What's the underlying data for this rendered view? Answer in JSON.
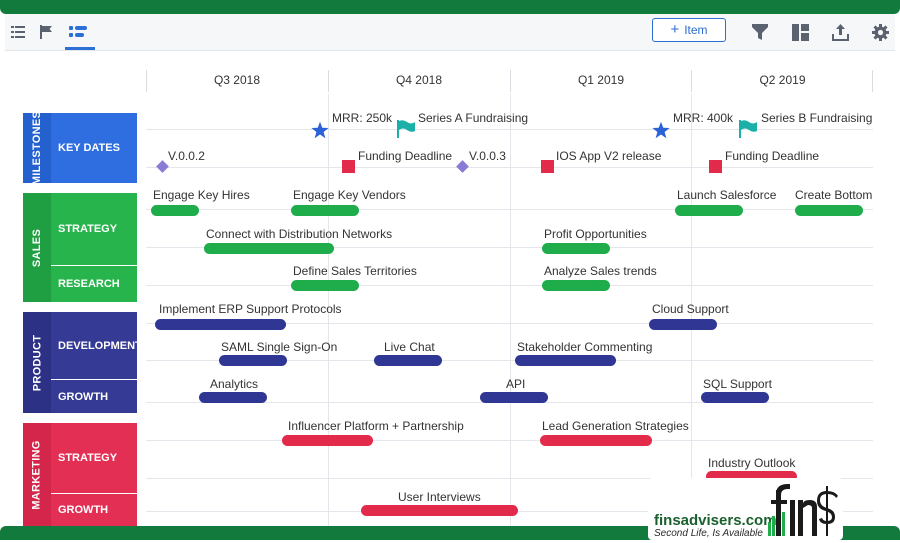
{
  "toolbar": {
    "add_button_label": "Item",
    "add_button_icon": "plus-icon",
    "left_icons": [
      "list-view-icon",
      "flag-icon",
      "timeline-icon"
    ],
    "right_icons": [
      "filter-icon",
      "layout-icon",
      "export-icon",
      "gear-icon"
    ]
  },
  "timeline": {
    "quarters": [
      "Q3 2018",
      "Q4 2018",
      "Q1 2019",
      "Q2 2019"
    ]
  },
  "groups": [
    {
      "name": "MILESTONES",
      "color": "#2e6ee0",
      "rows": [
        "KEY DATES"
      ]
    },
    {
      "name": "SALES",
      "color": "#27b44d",
      "rows": [
        "STRATEGY",
        "RESEARCH"
      ]
    },
    {
      "name": "PRODUCT",
      "color": "#353a94",
      "rows": [
        "DEVELOPMENT",
        "GROWTH"
      ]
    },
    {
      "name": "MARKETING",
      "color": "#e42f55",
      "rows": [
        "STRATEGY",
        "GROWTH"
      ]
    }
  ],
  "milestones": [
    {
      "label": "MRR: 250k",
      "shape": "star-icon"
    },
    {
      "label": "Series A Fundraising",
      "shape": "flag-icon"
    },
    {
      "label": "MRR: 400k",
      "shape": "star-icon"
    },
    {
      "label": "Series B Fundraising",
      "shape": "flag-icon"
    },
    {
      "label": "V.0.0.2",
      "shape": "diamond-icon"
    },
    {
      "label": "Funding Deadline",
      "shape": "square-icon"
    },
    {
      "label": "V.0.0.3",
      "shape": "diamond-icon"
    },
    {
      "label": "IOS App V2 release",
      "shape": "square-icon"
    },
    {
      "label": "Funding Deadline",
      "shape": "square-icon"
    }
  ],
  "sales_bars": [
    "Engage Key Hires",
    "Engage Key Vendors",
    "Launch Salesforce",
    "Create Bottom",
    "Connect with Distribution Networks",
    "Profit Opportunities",
    "Define Sales Territories",
    "Analyze Sales trends"
  ],
  "product_bars": [
    "Implement ERP Support Protocols",
    "Cloud Support",
    "SAML Single Sign-On",
    "Live Chat",
    "Stakeholder Commenting",
    "Analytics",
    "API",
    "SQL Support"
  ],
  "marketing_bars": [
    "Influencer Platform + Partnership",
    "Lead Generation Strategies",
    "Industry Outlook",
    "User Interviews"
  ],
  "watermark": {
    "site": "finsadvisers.com",
    "tagline": "Second  Life, Is Available",
    "logo_text": "fin$"
  }
}
